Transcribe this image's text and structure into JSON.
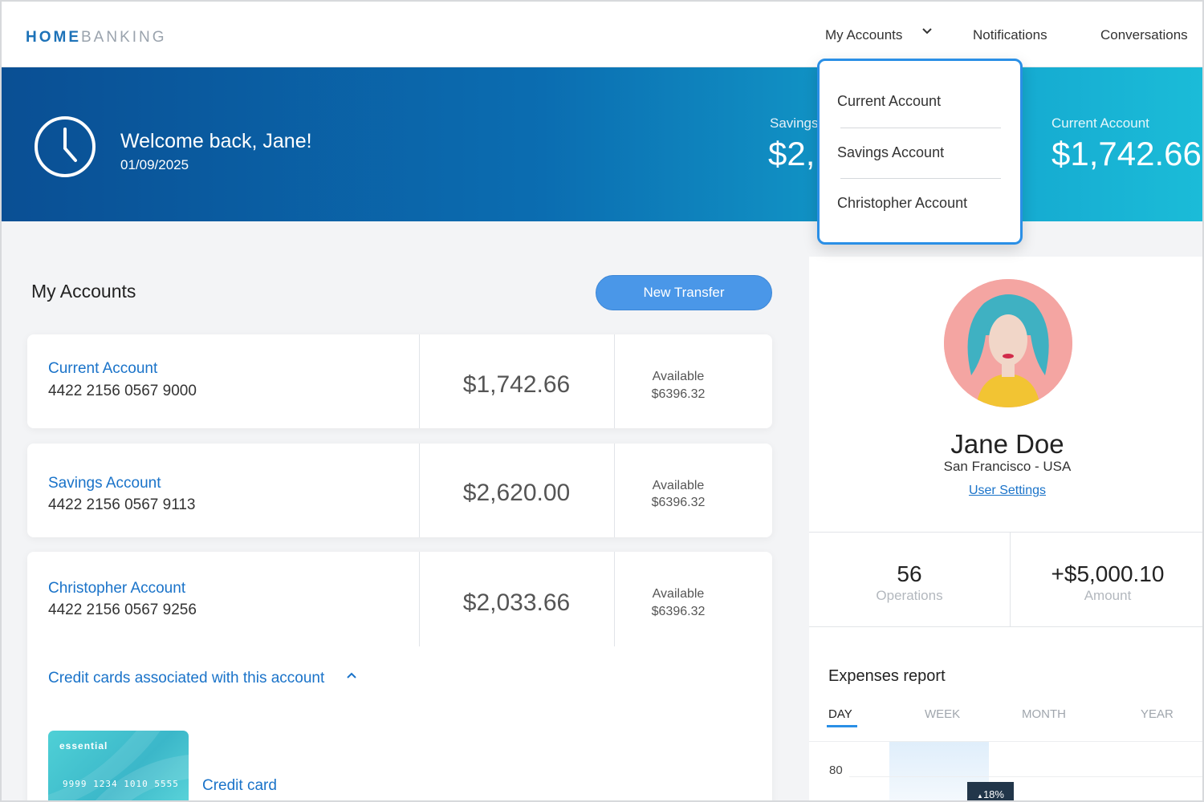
{
  "brand": {
    "logo_strong": "HOME",
    "logo_light": "BANKING"
  },
  "nav": {
    "accounts": "My Accounts",
    "notifications": "Notifications",
    "conversations": "Conversations"
  },
  "dropdown": {
    "items": [
      "Current Account",
      "Savings Account",
      "Christopher Account"
    ]
  },
  "hero": {
    "welcome": "Welcome back, Jane!",
    "date": "01/09/2025",
    "savings_label": "Savings",
    "savings_value": "$2,",
    "current_label": "Current Account",
    "current_value": "$1,742.66"
  },
  "accounts": {
    "title": "My Accounts",
    "new_transfer": "New Transfer",
    "list": [
      {
        "name": "Current Account",
        "number": "4422 2156 0567 9000",
        "balance": "$1,742.66",
        "available_label": "Available",
        "available_value": "$6396.32"
      },
      {
        "name": "Savings Account",
        "number": "4422 2156 0567 9113",
        "balance": "$2,620.00",
        "available_label": "Available",
        "available_value": "$6396.32"
      },
      {
        "name": "Christopher Account",
        "number": "4422 2156 0567 9256",
        "balance": "$2,033.66",
        "available_label": "Available",
        "available_value": "$6396.32"
      }
    ],
    "credit_link": "Credit cards associated with this account",
    "card_brand": "essential",
    "card_digits": "9999 1234 1010 5555",
    "credit_card_label": "Credit card"
  },
  "profile": {
    "name": "Jane Doe",
    "location": "San Francisco - USA",
    "settings": "User Settings",
    "operations_value": "56",
    "operations_label": "Operations",
    "amount_value": "+$5,000.10",
    "amount_label": "Amount"
  },
  "expenses": {
    "title": "Expenses report",
    "tabs": [
      "DAY",
      "WEEK",
      "MONTH",
      "YEAR"
    ],
    "tick": "80",
    "badge": "18%"
  },
  "colors": {
    "accent": "#1a73c9",
    "button": "#4a97e8",
    "hero_start": "#0a4f94",
    "hero_end": "#1bbcd8"
  }
}
